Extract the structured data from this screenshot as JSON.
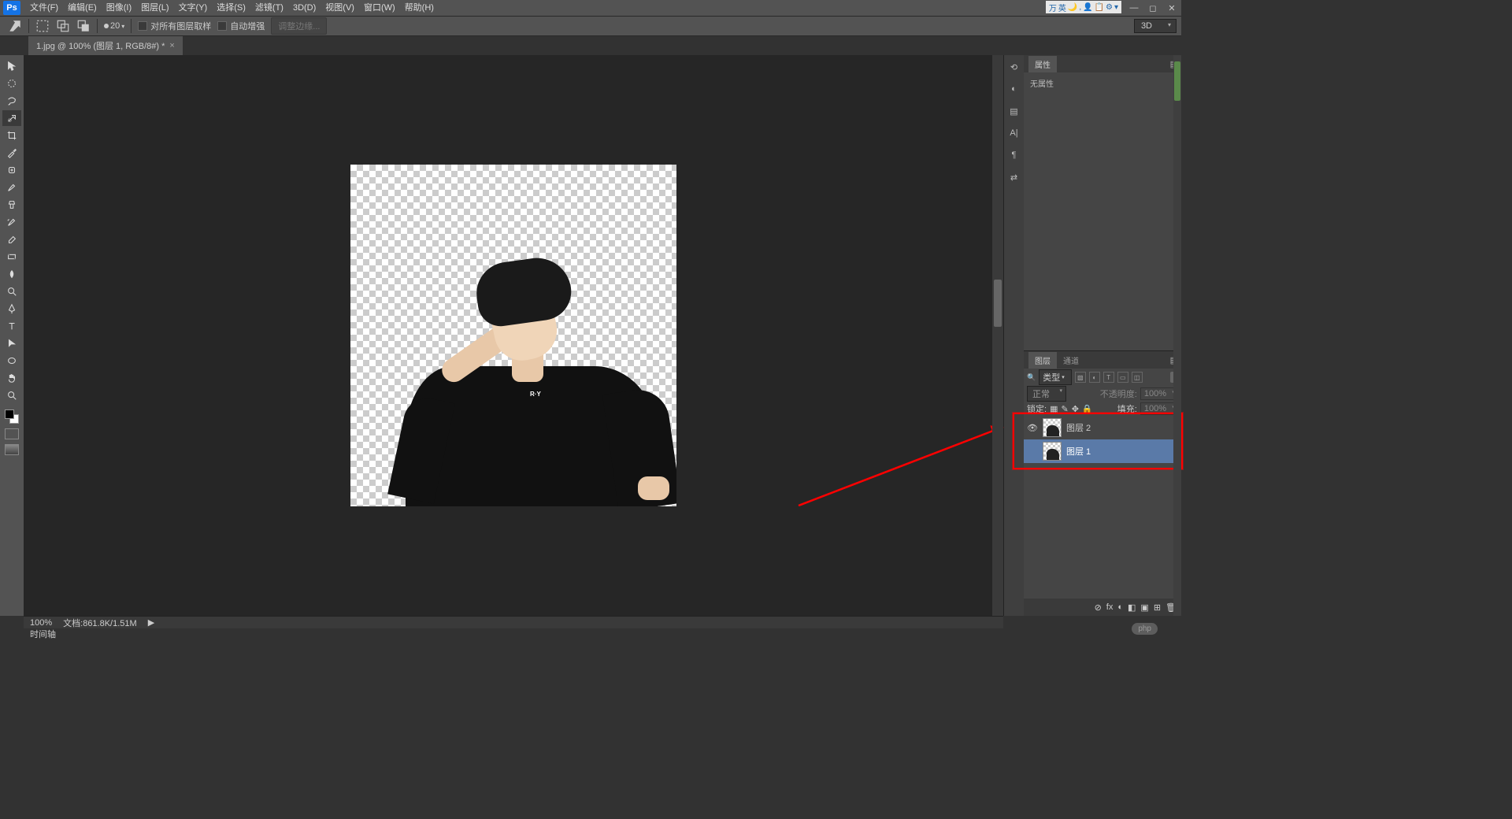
{
  "app": {
    "logo": "Ps"
  },
  "menu": [
    "文件(F)",
    "编辑(E)",
    "图像(I)",
    "图层(L)",
    "文字(Y)",
    "选择(S)",
    "滤镜(T)",
    "3D(D)",
    "视图(V)",
    "窗口(W)",
    "帮助(H)"
  ],
  "ime": [
    "万",
    "英",
    "🌙",
    ",",
    "👤",
    "📋",
    "⚙",
    "▾"
  ],
  "options": {
    "brush_size": "20",
    "sample_all": "对所有图层取样",
    "auto_enhance": "自动增强",
    "refine_edge": "调整边缘...",
    "mode3d": "3D"
  },
  "doc": {
    "title": "1.jpg @ 100% (图层 1, RGB/8#) *",
    "close": "×"
  },
  "canvas": {
    "shirt_text": "R·Y"
  },
  "props": {
    "tab": "属性",
    "body": "无属性"
  },
  "layers": {
    "tab1": "图层",
    "tab2": "通道",
    "filter_label": "类型",
    "blend": "正常",
    "opacity_label": "不透明度:",
    "opacity_value": "100%",
    "lock_label": "锁定:",
    "fill_label": "填充:",
    "fill_value": "100%",
    "items": [
      {
        "name": "图层 2",
        "visible": true
      },
      {
        "name": "图层 1",
        "visible": false
      }
    ],
    "footer_icons": [
      "⊘",
      "fx",
      "◐",
      "◧",
      "▣",
      "⊞",
      "🗑"
    ]
  },
  "status": {
    "zoom": "100%",
    "docinfo": "文档:861.8K/1.51M",
    "arrow": "▶"
  },
  "timeline": {
    "label": "时间轴"
  },
  "watermark": "php"
}
